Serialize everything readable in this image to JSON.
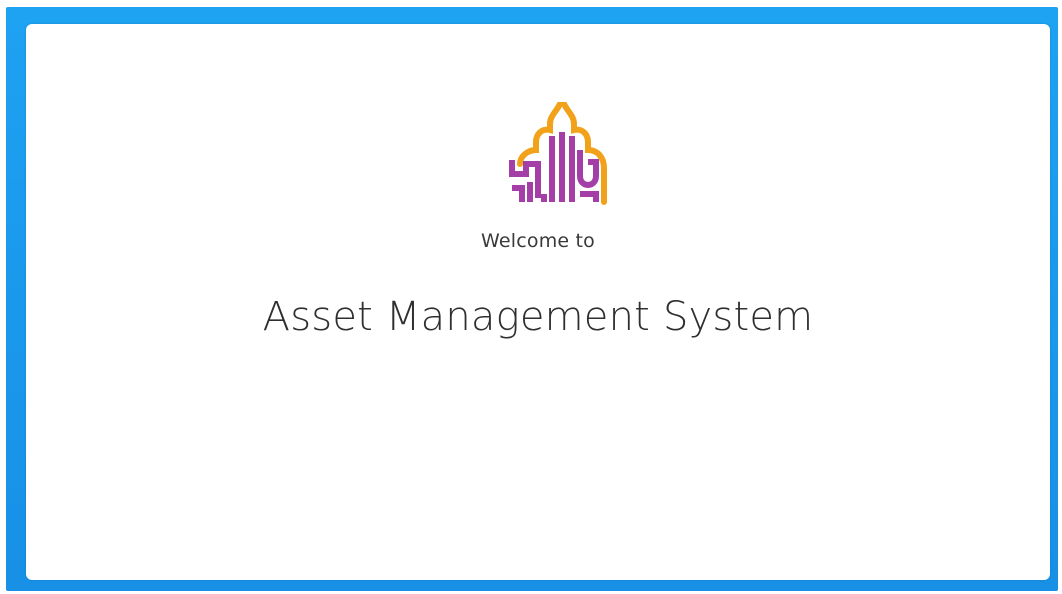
{
  "page": {
    "welcome_text": "Welcome to",
    "title": "Asset Management System",
    "logo_icon": "institution-logo-icon"
  },
  "colors": {
    "frame": "#1a97ea",
    "logo_purple": "#a53fa8",
    "logo_orange": "#f2a11a",
    "text": "#2f2f2f"
  }
}
